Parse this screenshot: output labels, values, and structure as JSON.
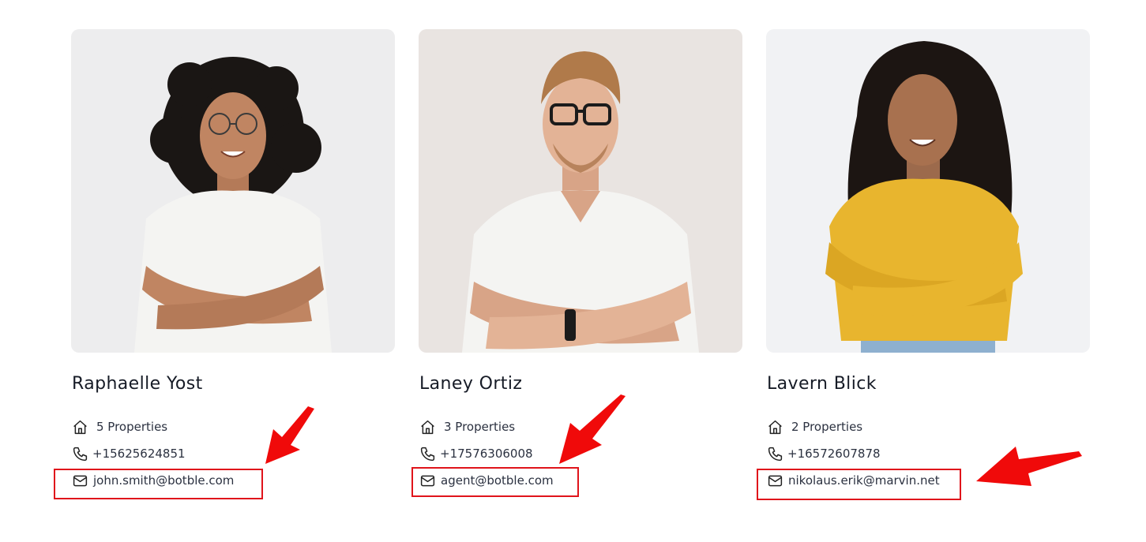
{
  "agents": [
    {
      "name": "Raphaelle Yost",
      "properties": "5 Properties",
      "phone": "+15625624851",
      "email": "john.smith@botble.com"
    },
    {
      "name": "Laney Ortiz",
      "properties": "3 Properties",
      "phone": "+17576306008",
      "email": "agent@botble.com"
    },
    {
      "name": "Lavern Blick",
      "properties": "2 Properties",
      "phone": "+16572607878",
      "email": "nikolaus.erik@marvin.net"
    }
  ],
  "icons": {
    "properties": "house-icon",
    "phone": "phone-icon",
    "email": "mail-icon",
    "annotation": "red-arrow-icon"
  },
  "colors": {
    "highlight": "#e0141b",
    "text": "#1f2530",
    "shirt_white": "#f4f4f2",
    "sweater_yellow": "#e8b52e"
  }
}
